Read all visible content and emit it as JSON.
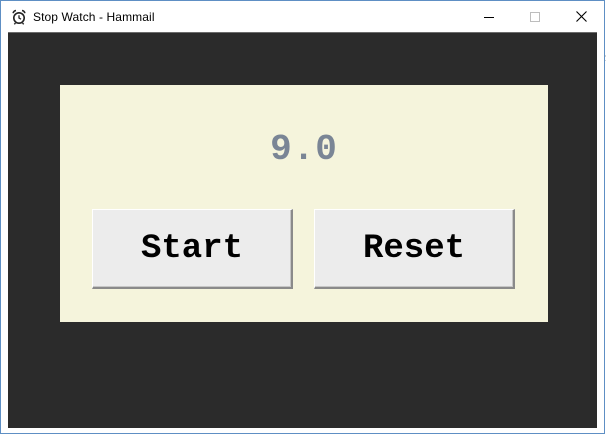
{
  "window": {
    "title": "Stop Watch - Hammail",
    "app_icon": "alarm-clock-icon",
    "controls": [
      "minimize-icon",
      "maximize-icon",
      "close-icon"
    ]
  },
  "stopwatch": {
    "time": "9.0",
    "start_label": "Start",
    "reset_label": "Reset"
  },
  "colors": {
    "client_background": "#2b2b2b",
    "panel_background": "#f5f4dc",
    "time_text": "#7a8595",
    "button_face": "#ececec"
  }
}
